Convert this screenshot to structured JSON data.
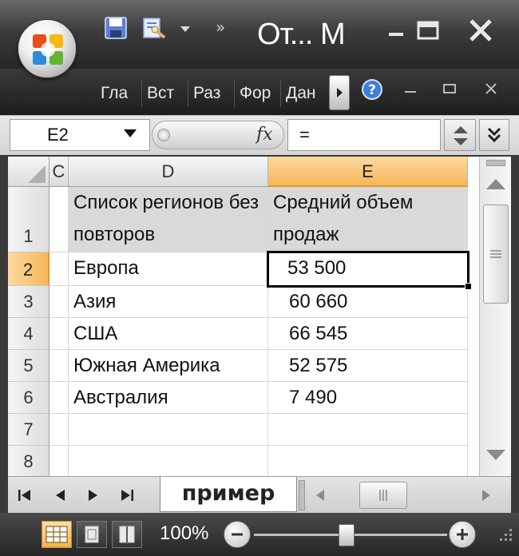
{
  "window": {
    "title": "От... М",
    "office_button_icon": "office-logo-icon"
  },
  "quick_access": {
    "save_icon": "save-disk-icon",
    "print_icon": "print-preview-icon"
  },
  "ribbon": {
    "tabs": [
      "Гла",
      "Вст",
      "Раз",
      "Фор",
      "Дан"
    ]
  },
  "formula_bar": {
    "name_box": "E2",
    "fx_label": "fx",
    "formula": "="
  },
  "sheet": {
    "columns": [
      "C",
      "D",
      "E"
    ],
    "active_column": "E",
    "rows": [
      {
        "num": "1",
        "d": "Список регионов без повторов",
        "e": "Средний объем продаж"
      },
      {
        "num": "2",
        "d": "Европа",
        "e": "53 500"
      },
      {
        "num": "3",
        "d": "Азия",
        "e": "60 660"
      },
      {
        "num": "4",
        "d": "США",
        "e": "66 545"
      },
      {
        "num": "5",
        "d": "Южная Америка",
        "e": "52 575"
      },
      {
        "num": "6",
        "d": "Австралия",
        "e": "7 490"
      },
      {
        "num": "7",
        "d": "",
        "e": ""
      },
      {
        "num": "8",
        "d": "",
        "e": ""
      }
    ],
    "active_row": "2",
    "active_cell": "E2"
  },
  "sheet_tabs": {
    "active": "пример"
  },
  "status": {
    "zoom": "100%",
    "zoom_level": 1.0
  },
  "colors": {
    "header_highlight": "#f5b758",
    "header_fill": "#d9d9d9",
    "chrome_dark": "#262626"
  }
}
